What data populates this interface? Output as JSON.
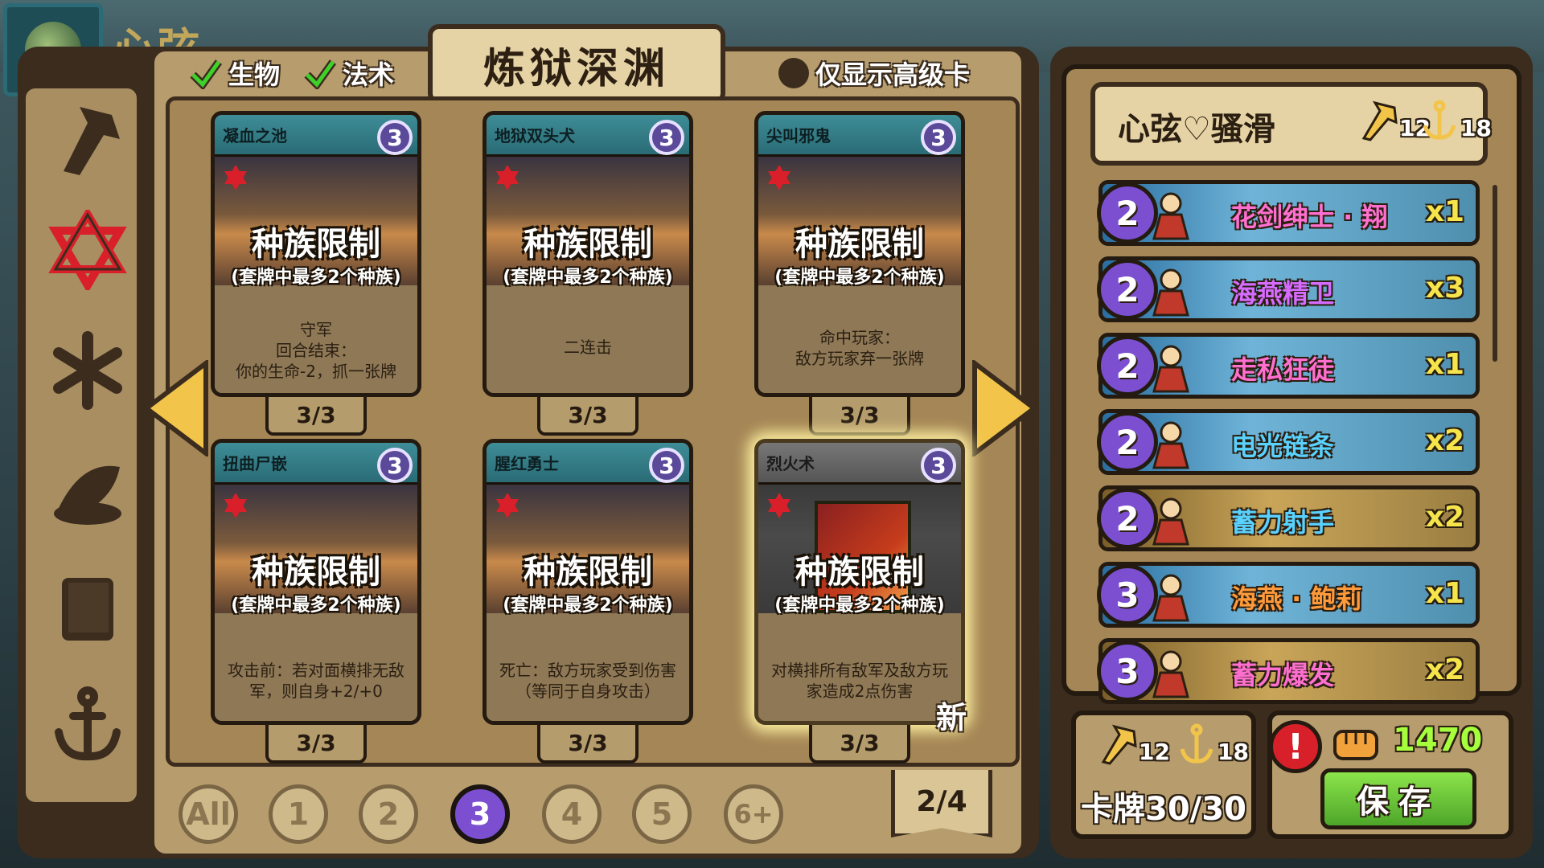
{
  "top": {
    "title": "心弦"
  },
  "filters": {
    "creature": "生物",
    "spell": "法术",
    "premium_only": "仅显示高级卡"
  },
  "tab": {
    "title": "炼狱深渊"
  },
  "overlay": {
    "title": "种族限制",
    "subtitle": "(套牌中最多2个种族)"
  },
  "cards": [
    {
      "name": "凝血之池",
      "cost": "3",
      "desc": "守军\n回合结束：\n你的生命-2，抓一张牌",
      "count": "3/3"
    },
    {
      "name": "地狱双头犬",
      "cost": "3",
      "desc": "二连击",
      "count": "3/3"
    },
    {
      "name": "尖叫邪鬼",
      "cost": "3",
      "desc": "命中玩家：\n敌方玩家弃一张牌",
      "count": "3/3"
    },
    {
      "name": "扭曲尸嵌",
      "cost": "3",
      "desc": "攻击前：若对面横排无敌\n军，则自身+2/+0",
      "count": "3/3"
    },
    {
      "name": "腥红勇士",
      "cost": "3",
      "desc": "死亡：敌方玩家受到伤害\n（等同于自身攻击）",
      "count": "3/3"
    },
    {
      "name": "烈火术",
      "cost": "3",
      "desc": "对横排所有敌军及敌方玩\n家造成2点伤害",
      "count": "3/3",
      "new_label": "新"
    }
  ],
  "cost_filters": [
    "All",
    "1",
    "2",
    "3",
    "4",
    "5",
    "6+"
  ],
  "active_cost": "3",
  "page": "2/4",
  "deck": {
    "name": "心弦♡骚滑",
    "stat_a": "12",
    "stat_b": "18",
    "rows": [
      {
        "cost": "2",
        "name": "花剑绅士 · 翔",
        "count": "x1",
        "name_color": "#ff6fd0",
        "bg": "ocean",
        "portrait": "swordsman-icon"
      },
      {
        "cost": "2",
        "name": "海燕精卫",
        "count": "x3",
        "name_color": "#d66bff",
        "bg": "ocean",
        "portrait": "gunner-icon"
      },
      {
        "cost": "2",
        "name": "走私狂徒",
        "count": "x1",
        "name_color": "#ff6fd0",
        "bg": "ocean",
        "portrait": "pirate-icon"
      },
      {
        "cost": "2",
        "name": "电光链条",
        "count": "x2",
        "name_color": "#5ad2ff",
        "bg": "ocean",
        "portrait": "lightning-icon"
      },
      {
        "cost": "2",
        "name": "蓄力射手",
        "count": "x2",
        "name_color": "#5ad2ff",
        "bg": "forest",
        "portrait": "archer-icon"
      },
      {
        "cost": "3",
        "name": "海燕 · 鲍莉",
        "count": "x1",
        "name_color": "#ff9a3a",
        "bg": "ocean",
        "portrait": "captain-icon"
      },
      {
        "cost": "3",
        "name": "蓄力爆发",
        "count": "x2",
        "name_color": "#ff6fd0",
        "bg": "forest",
        "portrait": "burst-icon"
      }
    ]
  },
  "footer": {
    "stat_a": "12",
    "stat_b": "18",
    "card_count": "卡牌30/30",
    "gold": "1470",
    "save": "保存"
  }
}
